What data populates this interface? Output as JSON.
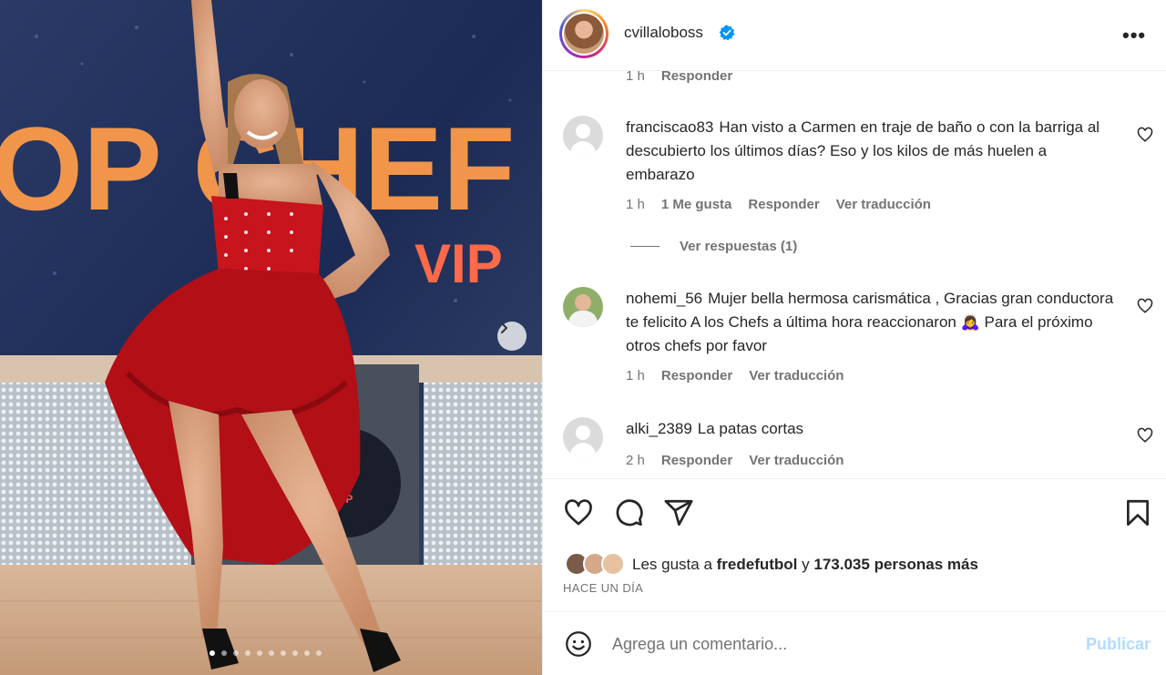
{
  "post": {
    "username": "cvillaloboss",
    "verified": true,
    "more_label": "•••"
  },
  "top_partial": {
    "time": "1 h",
    "reply": "Responder"
  },
  "comments": [
    {
      "user": "franciscao83",
      "text": "Han visto a Carmen en traje de baño o con la barriga al descubierto los últimos días? Eso y los kilos de más huelen a embarazo",
      "time": "1 h",
      "likes": "1 Me gusta",
      "reply": "Responder",
      "translate": "Ver traducción",
      "view_replies": "Ver respuestas (1)"
    },
    {
      "user": "nohemi_56",
      "text": "Mujer bella hermosa carismática , Gracias gran conductora te felicito A los Chefs a última hora reaccionaron 🙇‍♀️ Para el próximo otros chefs por favor",
      "time": "1 h",
      "reply": "Responder",
      "translate": "Ver traducción"
    },
    {
      "user": "alki_2389",
      "text": "La patas cortas",
      "time": "2 h",
      "reply": "Responder",
      "translate": "Ver traducción"
    }
  ],
  "likes": {
    "prefix": "Les gusta a",
    "user": "fredefutbol",
    "connector": "y",
    "count": "173.035 personas más"
  },
  "time_ago": "HACE UN DÍA",
  "composer": {
    "placeholder": "Agrega un comentario...",
    "publish": "Publicar"
  },
  "media": {
    "backdrop_text": "OP CHEF",
    "backdrop_sub": "VIP",
    "logo_text": "EF",
    "logo_sub": "VIP",
    "carousel_total": 10,
    "carousel_index": 1
  },
  "colors": {
    "verified": "#0095f6",
    "publish_disabled": "#b3dbff",
    "dress": "#c8141c"
  }
}
